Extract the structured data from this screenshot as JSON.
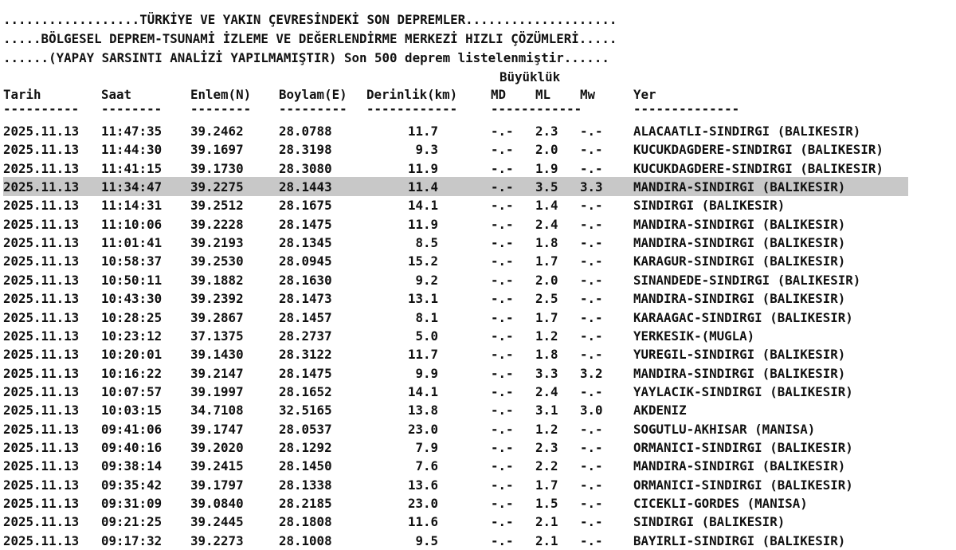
{
  "header": {
    "line1": "..................TÜRKİYE VE YAKIN ÇEVRESİNDEKİ SON DEPREMLER....................",
    "line2": ".....BÖLGESEL DEPREM-TSUNAMİ İZLEME VE DEĞERLENDİRME MERKEZİ HIZLI ÇÖZÜMLERİ.....",
    "line3": "......(YAPAY SARSINTI ANALİZİ YAPILMAMIŞTIR) Son 500 deprem listelenmiştir......"
  },
  "columns": {
    "magnitude_group": "Büyüklük",
    "tarih": "Tarih",
    "saat": "Saat",
    "enlem": "Enlem(N)",
    "boylam": "Boylam(E)",
    "derinlik": "Derinlik(km)",
    "md": "MD",
    "ml": "ML",
    "mw": "Mw",
    "yer": "Yer"
  },
  "separators": {
    "tarih": "----------",
    "saat": "--------",
    "enlem": "--------",
    "boylam": "---------",
    "derinlik": "------------",
    "mag": "------------",
    "yer": "--------------"
  },
  "highlighted_row": 3,
  "rows": [
    {
      "date": "2025.11.13",
      "time": "11:47:35",
      "lat": "39.2462",
      "lon": "28.0788",
      "depth": "11.7",
      "md": "-.-",
      "ml": "2.3",
      "mw": "-.-",
      "place": "ALACAATLI-SINDIRGI (BALIKESIR)"
    },
    {
      "date": "2025.11.13",
      "time": "11:44:30",
      "lat": "39.1697",
      "lon": "28.3198",
      "depth": "9.3",
      "md": "-.-",
      "ml": "2.0",
      "mw": "-.-",
      "place": "KUCUKDAGDERE-SINDIRGI (BALIKESIR)"
    },
    {
      "date": "2025.11.13",
      "time": "11:41:15",
      "lat": "39.1730",
      "lon": "28.3080",
      "depth": "11.9",
      "md": "-.-",
      "ml": "1.9",
      "mw": "-.-",
      "place": "KUCUKDAGDERE-SINDIRGI (BALIKESIR)"
    },
    {
      "date": "2025.11.13",
      "time": "11:34:47",
      "lat": "39.2275",
      "lon": "28.1443",
      "depth": "11.4",
      "md": "-.-",
      "ml": "3.5",
      "mw": "3.3",
      "place": "MANDIRA-SINDIRGI (BALIKESIR)"
    },
    {
      "date": "2025.11.13",
      "time": "11:14:31",
      "lat": "39.2512",
      "lon": "28.1675",
      "depth": "14.1",
      "md": "-.-",
      "ml": "1.4",
      "mw": "-.-",
      "place": "SINDIRGI (BALIKESIR)"
    },
    {
      "date": "2025.11.13",
      "time": "11:10:06",
      "lat": "39.2228",
      "lon": "28.1475",
      "depth": "11.9",
      "md": "-.-",
      "ml": "2.4",
      "mw": "-.-",
      "place": "MANDIRA-SINDIRGI (BALIKESIR)"
    },
    {
      "date": "2025.11.13",
      "time": "11:01:41",
      "lat": "39.2193",
      "lon": "28.1345",
      "depth": "8.5",
      "md": "-.-",
      "ml": "1.8",
      "mw": "-.-",
      "place": "MANDIRA-SINDIRGI (BALIKESIR)"
    },
    {
      "date": "2025.11.13",
      "time": "10:58:37",
      "lat": "39.2530",
      "lon": "28.0945",
      "depth": "15.2",
      "md": "-.-",
      "ml": "1.7",
      "mw": "-.-",
      "place": "KARAGUR-SINDIRGI (BALIKESIR)"
    },
    {
      "date": "2025.11.13",
      "time": "10:50:11",
      "lat": "39.1882",
      "lon": "28.1630",
      "depth": "9.2",
      "md": "-.-",
      "ml": "2.0",
      "mw": "-.-",
      "place": "SINANDEDE-SINDIRGI (BALIKESIR)"
    },
    {
      "date": "2025.11.13",
      "time": "10:43:30",
      "lat": "39.2392",
      "lon": "28.1473",
      "depth": "13.1",
      "md": "-.-",
      "ml": "2.5",
      "mw": "-.-",
      "place": "MANDIRA-SINDIRGI (BALIKESIR)"
    },
    {
      "date": "2025.11.13",
      "time": "10:28:25",
      "lat": "39.2867",
      "lon": "28.1457",
      "depth": "8.1",
      "md": "-.-",
      "ml": "1.7",
      "mw": "-.-",
      "place": "KARAAGAC-SINDIRGI (BALIKESIR)"
    },
    {
      "date": "2025.11.13",
      "time": "10:23:12",
      "lat": "37.1375",
      "lon": "28.2737",
      "depth": "5.0",
      "md": "-.-",
      "ml": "1.2",
      "mw": "-.-",
      "place": "YERKESIK-(MUGLA)"
    },
    {
      "date": "2025.11.13",
      "time": "10:20:01",
      "lat": "39.1430",
      "lon": "28.3122",
      "depth": "11.7",
      "md": "-.-",
      "ml": "1.8",
      "mw": "-.-",
      "place": "YUREGIL-SINDIRGI (BALIKESIR)"
    },
    {
      "date": "2025.11.13",
      "time": "10:16:22",
      "lat": "39.2147",
      "lon": "28.1475",
      "depth": "9.9",
      "md": "-.-",
      "ml": "3.3",
      "mw": "3.2",
      "place": "MANDIRA-SINDIRGI (BALIKESIR)"
    },
    {
      "date": "2025.11.13",
      "time": "10:07:57",
      "lat": "39.1997",
      "lon": "28.1652",
      "depth": "14.1",
      "md": "-.-",
      "ml": "2.4",
      "mw": "-.-",
      "place": "YAYLACIK-SINDIRGI (BALIKESIR)"
    },
    {
      "date": "2025.11.13",
      "time": "10:03:15",
      "lat": "34.7108",
      "lon": "32.5165",
      "depth": "13.8",
      "md": "-.-",
      "ml": "3.1",
      "mw": "3.0",
      "place": "AKDENIZ"
    },
    {
      "date": "2025.11.13",
      "time": "09:41:06",
      "lat": "39.1747",
      "lon": "28.0537",
      "depth": "23.0",
      "md": "-.-",
      "ml": "1.2",
      "mw": "-.-",
      "place": "SOGUTLU-AKHISAR (MANISA)"
    },
    {
      "date": "2025.11.13",
      "time": "09:40:16",
      "lat": "39.2020",
      "lon": "28.1292",
      "depth": "7.9",
      "md": "-.-",
      "ml": "2.3",
      "mw": "-.-",
      "place": "ORMANICI-SINDIRGI (BALIKESIR)"
    },
    {
      "date": "2025.11.13",
      "time": "09:38:14",
      "lat": "39.2415",
      "lon": "28.1450",
      "depth": "7.6",
      "md": "-.-",
      "ml": "2.2",
      "mw": "-.-",
      "place": "MANDIRA-SINDIRGI (BALIKESIR)"
    },
    {
      "date": "2025.11.13",
      "time": "09:35:42",
      "lat": "39.1797",
      "lon": "28.1338",
      "depth": "13.6",
      "md": "-.-",
      "ml": "1.7",
      "mw": "-.-",
      "place": "ORMANICI-SINDIRGI (BALIKESIR)"
    },
    {
      "date": "2025.11.13",
      "time": "09:31:09",
      "lat": "39.0840",
      "lon": "28.2185",
      "depth": "23.0",
      "md": "-.-",
      "ml": "1.5",
      "mw": "-.-",
      "place": "CICEKLI-GORDES (MANISA)"
    },
    {
      "date": "2025.11.13",
      "time": "09:21:25",
      "lat": "39.2445",
      "lon": "28.1808",
      "depth": "11.6",
      "md": "-.-",
      "ml": "2.1",
      "mw": "-.-",
      "place": "SINDIRGI (BALIKESIR)"
    },
    {
      "date": "2025.11.13",
      "time": "09:17:32",
      "lat": "39.2273",
      "lon": "28.1008",
      "depth": "9.5",
      "md": "-.-",
      "ml": "2.1",
      "mw": "-.-",
      "place": "BAYIRLI-SINDIRGI (BALIKESIR)"
    }
  ]
}
